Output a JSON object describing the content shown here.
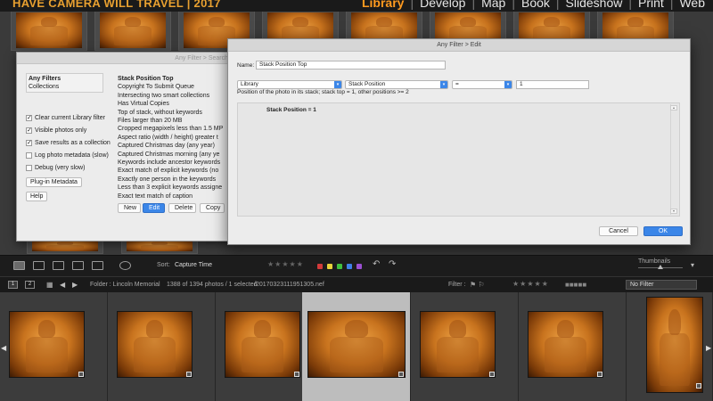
{
  "topbar": {
    "brand": "HAVE CAMERA WILL TRAVEL | 2017",
    "modules": [
      "Library",
      "Develop",
      "Map",
      "Book",
      "Slideshow",
      "Print",
      "Web"
    ],
    "active_module": "Library"
  },
  "library_filter_dialog": {
    "title": "Any Filter > Search",
    "presets": [
      "Any Filters",
      "Collections"
    ],
    "options": [
      {
        "label": "Clear current Library filter",
        "checked": true
      },
      {
        "label": "Visible photos only",
        "checked": true
      },
      {
        "label": "Save results as a collection",
        "checked": true
      },
      {
        "label": "Log photo metadata (slow)",
        "checked": false
      },
      {
        "label": "Debug (very slow)",
        "checked": false
      }
    ],
    "plugin_button": "Plug-in Metadata",
    "help_button": "Help",
    "filters": [
      "Stack Position Top",
      "Copyright To Submit Queue",
      "Intersecting two smart collections",
      "Has Virtual Copies",
      "Top of stack, without keywords",
      "Files larger than 20 MB",
      "Cropped megapixels less than 1.5 MP",
      "Aspect ratio (width / height) greater t",
      "Captured Christmas day (any year)",
      "Captured Christmas morning (any ye",
      "Keywords include ancestor keywords",
      "Exact match of explicit keywords (no",
      "Exactly one person in the keywords",
      "Less than 3 explicit keywords assigne",
      "Exact text match of caption"
    ],
    "buttons": {
      "new": "New",
      "edit": "Edit",
      "delete": "Delete",
      "copy": "Copy"
    }
  },
  "edit_dialog": {
    "title": "Any Filter > Edit",
    "name_label": "Name:",
    "name_value": "Stack Position Top",
    "category_select": "Library",
    "field_select": "Stack Position",
    "operator_select": "=",
    "value": "1",
    "hint": "Position of the photo in its stack; stack top = 1, other positions >= 2",
    "result": "Stack Position = 1",
    "cancel_label": "Cancel",
    "ok_label": "OK"
  },
  "toolbar": {
    "sort_label": "Sort:",
    "sort_value": "Capture Time",
    "stars": "★★★★★",
    "swatches": [
      "#d23a3a",
      "#e8d23a",
      "#3fbf3f",
      "#3f7fe8",
      "#9a4fd0"
    ],
    "thumbnails_label": "Thumbnails"
  },
  "status": {
    "page1": "1",
    "page2": "2",
    "folder": "Folder : Lincoln Memorial",
    "count": "1388 of 1394 photos / 1 selected",
    "file": "/20170323111951305.nef",
    "filter_label": "Filter :",
    "filter_stars": "★★★★★",
    "filter_value": "No Filter"
  },
  "filmstrip": {
    "count": 7,
    "selected_index": 3
  }
}
